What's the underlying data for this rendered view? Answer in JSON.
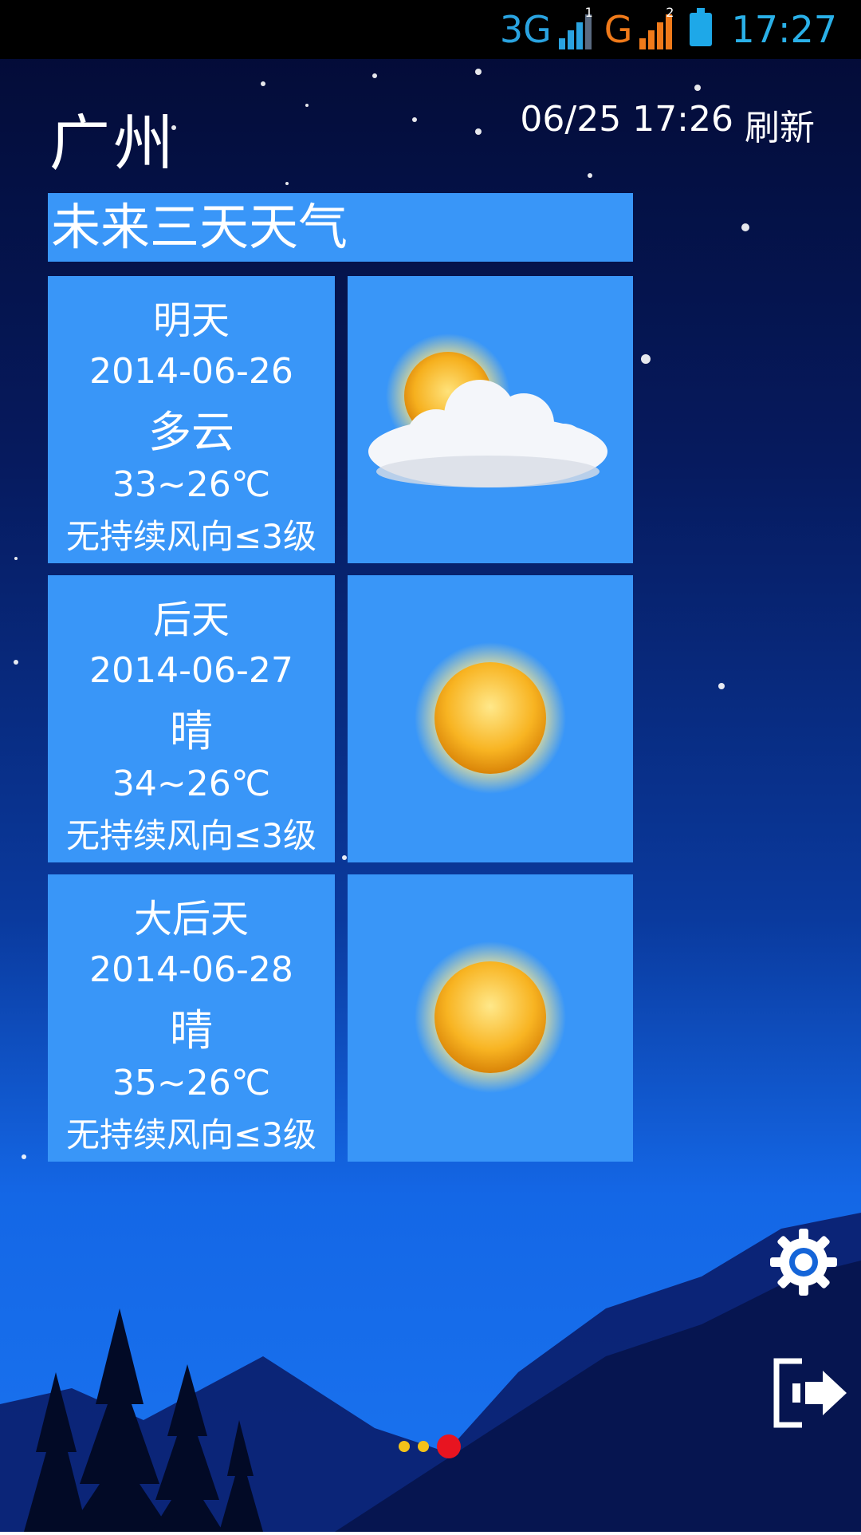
{
  "status_bar": {
    "network1": "3G",
    "sim1": "1",
    "network2": "G",
    "sim2": "2",
    "time": "17:27",
    "icons": [
      "signal-icon",
      "signal-icon",
      "battery-icon"
    ],
    "colors": {
      "network1": "#2aa3e0",
      "network2": "#f07a1a",
      "time": "#2ab0e8"
    }
  },
  "header": {
    "city": "广州",
    "update_time": "06/25 17:26",
    "refresh_label": "刷新"
  },
  "forecast": {
    "title": "未来三天天气",
    "days": [
      {
        "day": "明天",
        "date": "2014-06-26",
        "condition": "多云",
        "temp": "33~26℃",
        "wind": "无持续风向≤3级",
        "icon": "partly-cloudy-icon"
      },
      {
        "day": "后天",
        "date": "2014-06-27",
        "condition": "晴",
        "temp": "34~26℃",
        "wind": "无持续风向≤3级",
        "icon": "sunny-icon"
      },
      {
        "day": "大后天",
        "date": "2014-06-28",
        "condition": "晴",
        "temp": "35~26℃",
        "wind": "无持续风向≤3级",
        "icon": "sunny-icon"
      }
    ]
  },
  "controls": {
    "settings_icon": "gear-icon",
    "exit_icon": "exit-icon"
  },
  "pager": {
    "pages": 3,
    "current": 3
  },
  "colors": {
    "card": "#3996f8",
    "active_dot": "#e81420",
    "inactive_dot": "#f2c21a"
  }
}
